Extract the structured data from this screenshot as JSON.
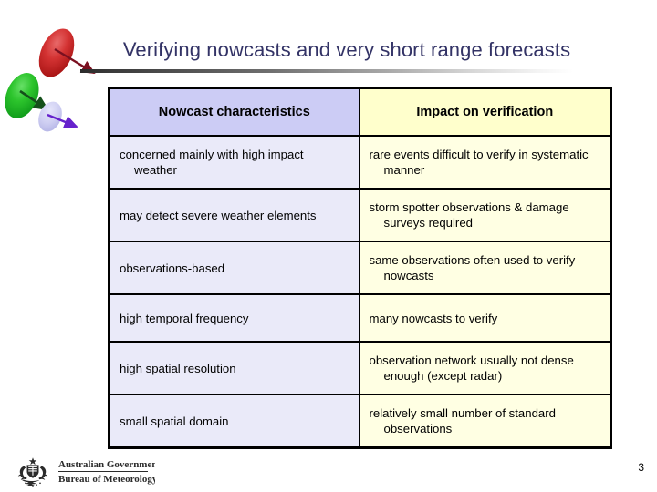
{
  "slide": {
    "title": "Verifying nowcasts and very short range forecasts",
    "page_number": "3"
  },
  "colors": {
    "title_text": "#333366",
    "header_left_bg": "#ccccf5",
    "header_right_bg": "#ffffcc",
    "body_left_bg": "#eaeaf9",
    "body_right_bg": "#ffffe3",
    "border": "#000000",
    "ellipse_red": "#cc2222",
    "ellipse_green": "#22bb22",
    "ellipse_lavender": "#ccccf2",
    "arrow_red": "#7a1020",
    "arrow_green": "#14501a",
    "arrow_violet": "#6622cc"
  },
  "table": {
    "headers": [
      "Nowcast characteristics",
      "Impact on verification"
    ],
    "rows": [
      {
        "characteristic": "concerned mainly with high impact weather",
        "impact": "rare events difficult to verify in systematic manner"
      },
      {
        "characteristic": "may detect severe weather elements",
        "impact": "storm spotter observations & damage surveys required"
      },
      {
        "characteristic": "observations-based",
        "impact": "same observations often used to verify nowcasts"
      },
      {
        "characteristic": "high temporal frequency",
        "impact": "many nowcasts to verify"
      },
      {
        "characteristic": "high spatial resolution",
        "impact": "observation network usually not dense enough (except radar)"
      },
      {
        "characteristic": "small spatial domain",
        "impact": "relatively small number of standard observations"
      }
    ]
  },
  "footer": {
    "org_line1": "Australian Government",
    "org_line2": "Bureau of Meteorology"
  }
}
